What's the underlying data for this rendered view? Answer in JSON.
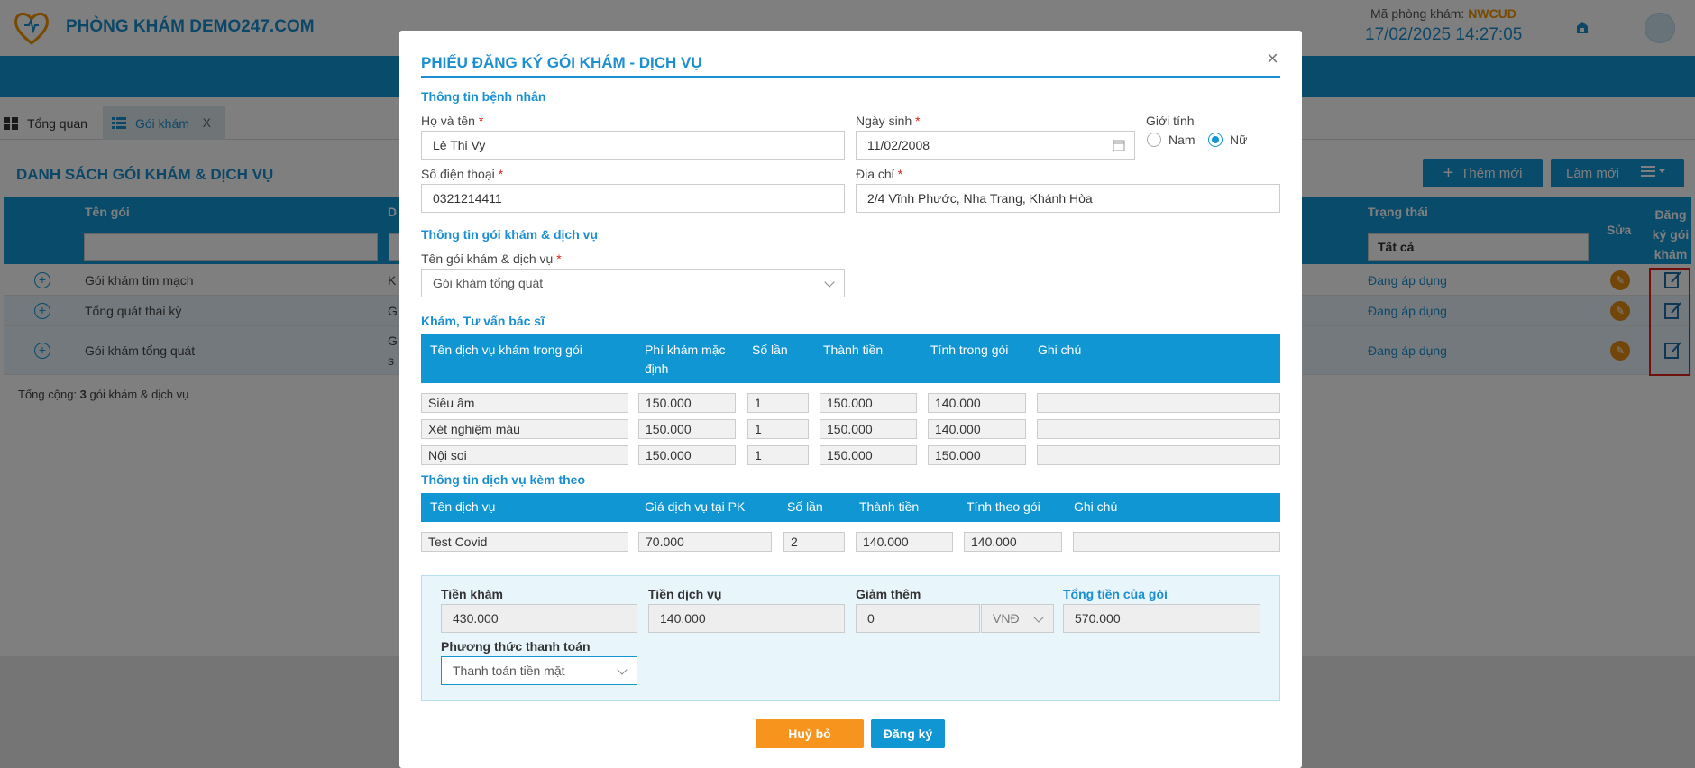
{
  "app": {
    "title": "PHÒNG KHÁM DEMO247.COM",
    "clinic_code_label": "Mã phòng khám:",
    "clinic_code": "NWCUD",
    "datetime": "17/02/2025 14:27:05"
  },
  "tabs": [
    {
      "label": "Tổng quan"
    },
    {
      "label": "Gói khám",
      "close": "X"
    }
  ],
  "list": {
    "title": "DANH SÁCH GÓI KHÁM & DỊCH VỤ",
    "add_label": "Thêm mới",
    "refresh_label": "Làm mới",
    "columns": {
      "name": "Tên gói",
      "col2": "D",
      "status": "Trạng thái",
      "edit": "Sửa",
      "register": "Đăng ký gói khám"
    },
    "status_filter": "Tất cả",
    "rows": [
      {
        "name": "Gói khám tim mạch",
        "col2": "K",
        "status": "Đang áp dụng"
      },
      {
        "name": "Tổng quát thai kỳ",
        "col2": "G",
        "status": "Đang áp dụng"
      },
      {
        "name": "Gói khám tổng quát",
        "col2": "G",
        "col2b": "s",
        "status": "Đang áp dụng"
      }
    ],
    "total_prefix": "Tổng cộng: ",
    "total_count": "3",
    "total_suffix": " gói khám & dịch vụ"
  },
  "modal": {
    "title": "PHIẾU ĐĂNG KÝ GÓI KHÁM - DỊCH VỤ",
    "patient_section": "Thông tin bệnh nhân",
    "name_label": "Họ và tên",
    "name_value": "Lê Thị Vy",
    "dob_label": "Ngày sinh",
    "dob_value": "11/02/2008",
    "gender_label": "Giới tính",
    "gender_male": "Nam",
    "gender_female": "Nữ",
    "phone_label": "Số điện thoại",
    "phone_value": "0321214411",
    "address_label": "Địa chỉ",
    "address_value": "2/4 Vĩnh Phước, Nha Trang, Khánh Hòa",
    "package_section": "Thông tin gói khám & dịch vụ",
    "package_label": "Tên gói khám & dịch vụ",
    "package_value": "Gói khám tổng quát",
    "exam_section": "Khám, Tư vấn bác sĩ",
    "exam_headers": [
      "Tên dịch vụ khám trong gói",
      "Phí khám mặc định",
      "Số lần",
      "Thành tiền",
      "Tính trong gói",
      "Ghi chú"
    ],
    "exam_rows": [
      {
        "name": "Siêu âm",
        "fee": "150.000",
        "count": "1",
        "amount": "150.000",
        "in_package": "140.000",
        "note": ""
      },
      {
        "name": "Xét nghiệm máu",
        "fee": "150.000",
        "count": "1",
        "amount": "150.000",
        "in_package": "140.000",
        "note": ""
      },
      {
        "name": "Nội soi",
        "fee": "150.000",
        "count": "1",
        "amount": "150.000",
        "in_package": "150.000",
        "note": ""
      }
    ],
    "service_section": "Thông tin dịch vụ kèm theo",
    "service_headers": [
      "Tên dịch vụ",
      "Giá dịch vụ tại PK",
      "Số lần",
      "Thành tiền",
      "Tính theo gói",
      "Ghi chú"
    ],
    "service_rows": [
      {
        "name": "Test Covid",
        "price": "70.000",
        "count": "2",
        "amount": "140.000",
        "in_package": "140.000",
        "note": ""
      }
    ],
    "summary": {
      "exam_fee_label": "Tiền khám",
      "exam_fee": "430.000",
      "service_fee_label": "Tiền dịch vụ",
      "service_fee": "140.000",
      "discount_label": "Giảm thêm",
      "discount": "0",
      "discount_unit": "VNĐ",
      "total_label": "Tổng tiền của gói",
      "total": "570.000",
      "payment_label": "Phương thức thanh toán",
      "payment_value": "Thanh toán tiền mặt"
    },
    "cancel_label": "Huỷ bỏ",
    "submit_label": "Đăng ký"
  },
  "colors": {
    "primary": "#1196d4",
    "accent": "#f7941d",
    "highlight_box": "#e0201b"
  }
}
